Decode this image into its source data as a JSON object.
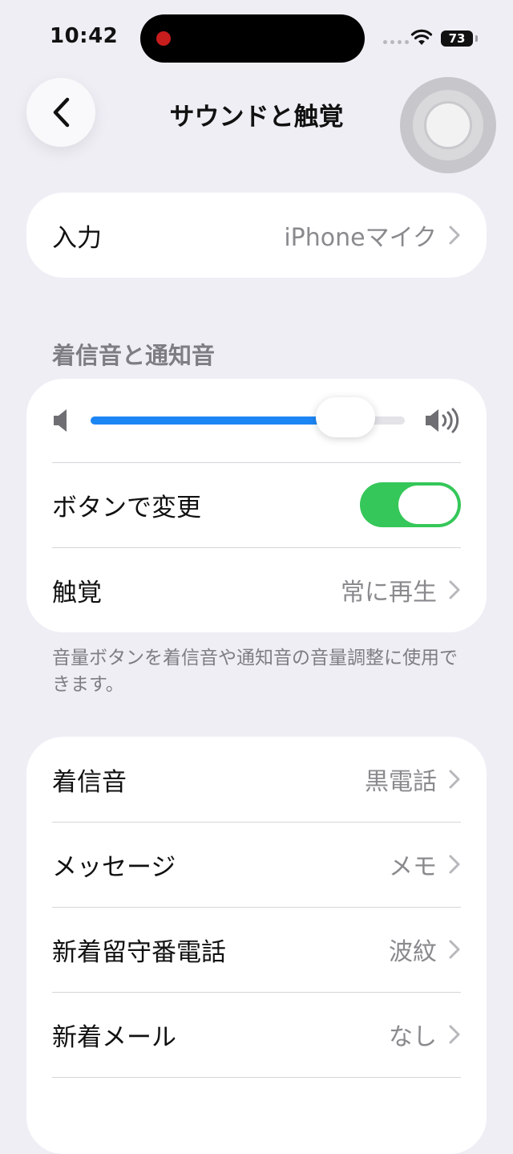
{
  "status_bar": {
    "time": "10:42",
    "battery": "73"
  },
  "nav": {
    "title": "サウンドと触覚"
  },
  "input": {
    "label": "入力",
    "value": "iPhoneマイク"
  },
  "ringtone_section": {
    "header": "着信音と通知音",
    "volume_level": 0.81,
    "change_with_buttons": {
      "label": "ボタンで変更",
      "on": true
    },
    "haptics": {
      "label": "触覚",
      "value": "常に再生"
    },
    "footer": "音量ボタンを着信音や通知音の音量調整に使用できます。"
  },
  "sounds": [
    {
      "label": "着信音",
      "value": "黒電話"
    },
    {
      "label": "メッセージ",
      "value": "メモ"
    },
    {
      "label": "新着留守番電話",
      "value": "波紋"
    },
    {
      "label": "新着メール",
      "value": "なし"
    }
  ],
  "colors": {
    "accent": "#1d86f5",
    "toggle_on": "#35c759",
    "background": "#efeef5"
  }
}
